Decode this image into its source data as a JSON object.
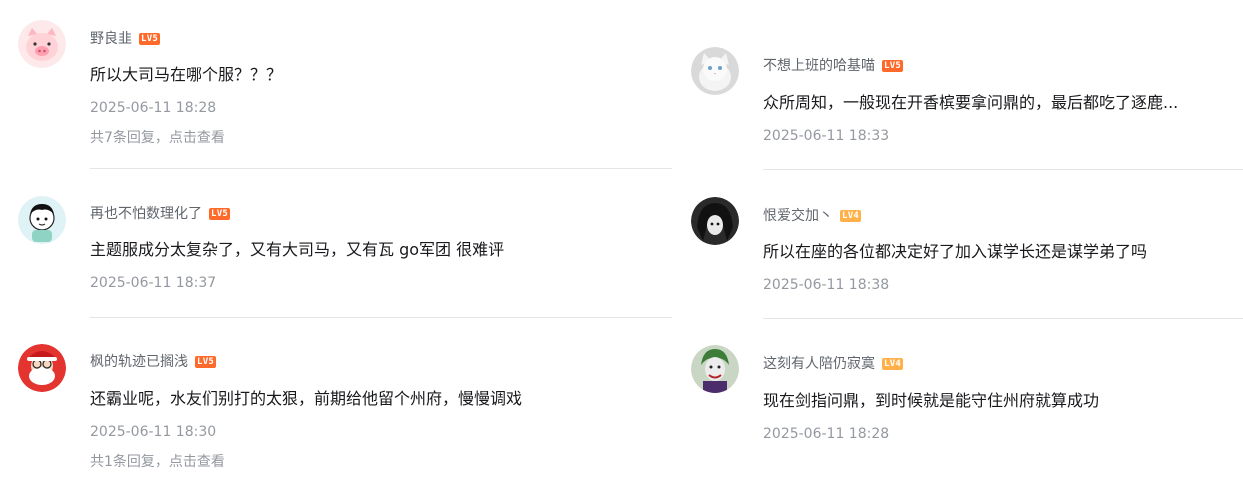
{
  "colors": {
    "lv5": "#ff6a2b",
    "lv4": "#ffb048"
  },
  "left_comments": [
    {
      "user": "野良韭",
      "level": "LV5",
      "content": "所以大司马在哪个服？？？",
      "time": "2025-06-11 18:28",
      "replies": "共7条回复，点击查看",
      "avatar_icon": "pig-avatar"
    },
    {
      "user": "再也不怕数理化了",
      "level": "LV5",
      "content": "主题服成分太复杂了，又有大司马，又有瓦 go军团 很难评",
      "time": "2025-06-11 18:37",
      "avatar_icon": "cartoon-boy-avatar"
    },
    {
      "user": "枫的轨迹已搁浅",
      "level": "LV5",
      "content": "还霸业呢，水友们别打的太狠，前期给他留个州府，慢慢调戏",
      "time": "2025-06-11 18:30",
      "replies": "共1条回复，点击查看",
      "avatar_icon": "santa-avatar"
    }
  ],
  "right_comments": [
    {
      "user": "不想上班的哈基喵",
      "level": "LV5",
      "content": "众所周知，一般现在开香槟要拿问鼎的，最后都吃了逐鹿...",
      "time": "2025-06-11 18:33",
      "avatar_icon": "white-cat-avatar"
    },
    {
      "user": "恨爱交加丶",
      "level": "LV4",
      "content": "所以在座的各位都决定好了加入谋学长还是谋学弟了吗",
      "time": "2025-06-11 18:38",
      "avatar_icon": "anime-girl-avatar"
    },
    {
      "user": "这刻有人陪仍寂寞",
      "level": "LV4",
      "content": "现在剑指问鼎，到时候就是能守住州府就算成功",
      "time": "2025-06-11 18:28",
      "avatar_icon": "joker-avatar"
    }
  ]
}
